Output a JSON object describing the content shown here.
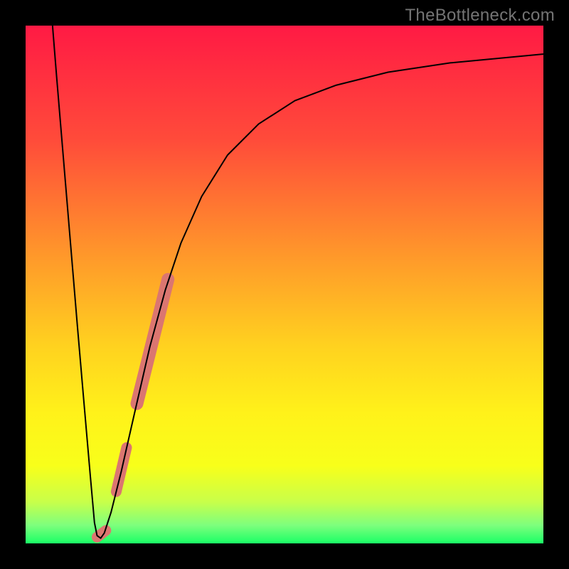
{
  "watermark": "TheBottleneck.com",
  "chart_data": {
    "type": "line",
    "title": "",
    "xlabel": "",
    "ylabel": "",
    "xlim": [
      0,
      100
    ],
    "ylim": [
      0,
      100
    ],
    "grid": false,
    "legend": false,
    "gradient_stops": [
      {
        "offset": 0.0,
        "color": "#ff1a44"
      },
      {
        "offset": 0.22,
        "color": "#ff4b3a"
      },
      {
        "offset": 0.45,
        "color": "#ff9a2a"
      },
      {
        "offset": 0.62,
        "color": "#ffd21f"
      },
      {
        "offset": 0.75,
        "color": "#fff21a"
      },
      {
        "offset": 0.85,
        "color": "#f8ff1a"
      },
      {
        "offset": 0.92,
        "color": "#c8ff4a"
      },
      {
        "offset": 0.965,
        "color": "#7dff7d"
      },
      {
        "offset": 1.0,
        "color": "#1aff66"
      }
    ],
    "series": [
      {
        "name": "bottleneck-curve",
        "stroke": "#000000",
        "stroke_width": 2,
        "points": [
          {
            "x": 5.2,
            "y": 100.0
          },
          {
            "x": 6.0,
            "y": 90.0
          },
          {
            "x": 7.0,
            "y": 78.0
          },
          {
            "x": 8.5,
            "y": 60.0
          },
          {
            "x": 10.0,
            "y": 42.0
          },
          {
            "x": 11.2,
            "y": 28.0
          },
          {
            "x": 12.5,
            "y": 13.0
          },
          {
            "x": 13.3,
            "y": 4.0
          },
          {
            "x": 13.8,
            "y": 1.5
          },
          {
            "x": 14.5,
            "y": 1.0
          },
          {
            "x": 15.2,
            "y": 2.0
          },
          {
            "x": 16.5,
            "y": 6.0
          },
          {
            "x": 18.5,
            "y": 14.0
          },
          {
            "x": 21.0,
            "y": 25.0
          },
          {
            "x": 24.0,
            "y": 38.0
          },
          {
            "x": 27.0,
            "y": 49.0
          },
          {
            "x": 30.0,
            "y": 58.0
          },
          {
            "x": 34.0,
            "y": 67.0
          },
          {
            "x": 39.0,
            "y": 75.0
          },
          {
            "x": 45.0,
            "y": 81.0
          },
          {
            "x": 52.0,
            "y": 85.5
          },
          {
            "x": 60.0,
            "y": 88.5
          },
          {
            "x": 70.0,
            "y": 91.0
          },
          {
            "x": 82.0,
            "y": 92.8
          },
          {
            "x": 100.0,
            "y": 94.5
          }
        ]
      }
    ],
    "highlight_segments": [
      {
        "name": "highlight-upper",
        "stroke": "#db7670",
        "stroke_width": 18,
        "points": [
          {
            "x": 21.5,
            "y": 27.0
          },
          {
            "x": 27.5,
            "y": 51.0
          }
        ]
      },
      {
        "name": "highlight-dot-mid",
        "stroke": "#db7670",
        "stroke_width": 15,
        "points": [
          {
            "x": 17.5,
            "y": 10.0
          },
          {
            "x": 19.5,
            "y": 18.5
          }
        ]
      },
      {
        "name": "highlight-dot-low",
        "stroke": "#db7670",
        "stroke_width": 15,
        "points": [
          {
            "x": 13.8,
            "y": 1.2
          },
          {
            "x": 15.5,
            "y": 2.5
          }
        ]
      }
    ]
  }
}
